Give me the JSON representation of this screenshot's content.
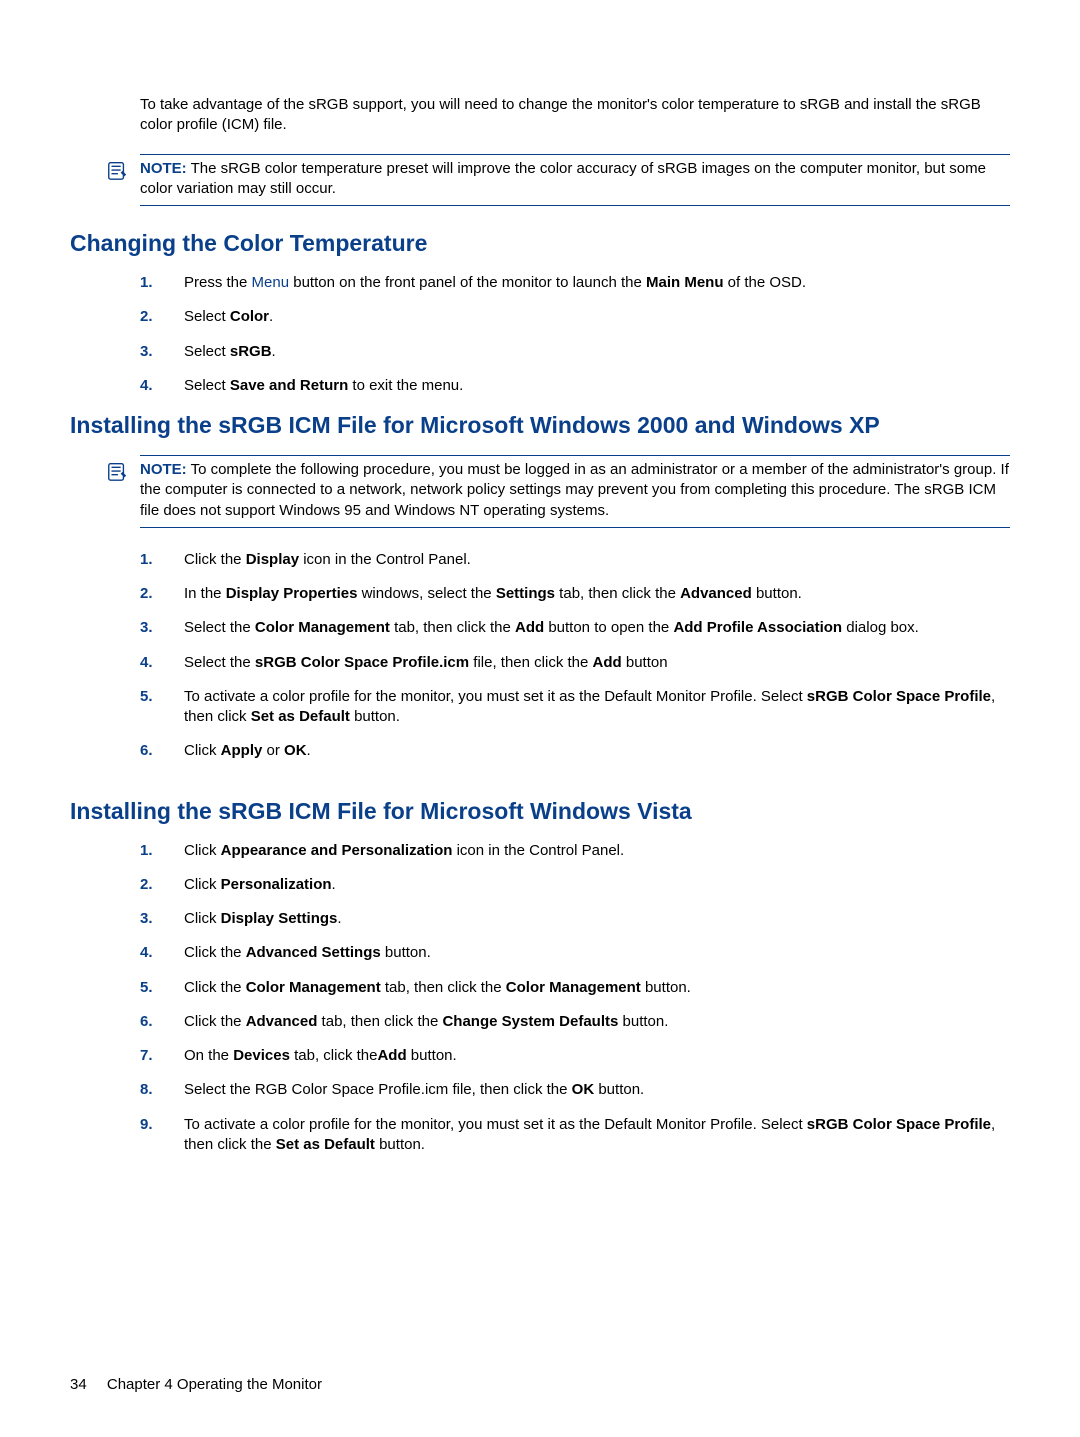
{
  "intro": {
    "para": "To take advantage of the sRGB support, you will need to change the monitor's color temperature to sRGB and install the sRGB color profile (ICM) file.",
    "note_label": "NOTE:",
    "note_text": "The sRGB color temperature preset will improve the color accuracy of sRGB images on the computer monitor, but some color variation may still occur."
  },
  "sec1": {
    "title": "Changing the Color Temperature",
    "steps": {
      "s1a": "Press the ",
      "s1_link": "Menu",
      "s1b": " button on the front panel of the monitor to launch the ",
      "s1_bold": "Main Menu",
      "s1c": " of the OSD.",
      "s2a": "Select ",
      "s2_bold": "Color",
      "s2b": ".",
      "s3a": "Select ",
      "s3_bold": "sRGB",
      "s3b": ".",
      "s4a": "Select ",
      "s4_bold": "Save and Return",
      "s4b": " to exit the menu."
    }
  },
  "sec2": {
    "title": "Installing the sRGB ICM File for Microsoft Windows 2000 and Windows XP",
    "note_label": "NOTE:",
    "note_text": "To complete the following procedure, you must be logged in as an administrator or a member of the administrator's group. If the computer is connected to a network, network policy settings may prevent you from completing this procedure. The sRGB ICM file does not support Windows 95 and Windows NT operating systems.",
    "steps": {
      "s1a": "Click the ",
      "s1b1": "Display",
      "s1b": " icon in the Control Panel.",
      "s2a": "In the ",
      "s2b1": "Display Properties",
      "s2b": " windows, select the ",
      "s2b2": "Settings",
      "s2c": " tab, then click the ",
      "s2b3": "Advanced",
      "s2d": " button.",
      "s3a": "Select the ",
      "s3b1": "Color Management",
      "s3b": " tab, then click the ",
      "s3b2": "Add",
      "s3c": " button to open the ",
      "s3b3": "Add Profile Association",
      "s3d": " dialog box.",
      "s4a": "Select the ",
      "s4b1": "sRGB Color Space Profile.icm",
      "s4b": " file, then click the ",
      "s4b2": "Add",
      "s4c": " button",
      "s5a": "To activate a color profile for the monitor, you must set it as the Default Monitor Profile. Select ",
      "s5b1": "sRGB Color Space Profile",
      "s5b": ", then click ",
      "s5b2": "Set as Default",
      "s5c": " button.",
      "s6a": "Click ",
      "s6b1": "Apply",
      "s6b": " or ",
      "s6b2": "OK",
      "s6c": "."
    }
  },
  "sec3": {
    "title": "Installing the sRGB ICM File for Microsoft Windows Vista",
    "steps": {
      "s1a": "Click ",
      "s1b1": "Appearance and Personalization",
      "s1b": " icon in the Control Panel.",
      "s2a": "Click ",
      "s2b1": "Personalization",
      "s2b": ".",
      "s3a": "Click ",
      "s3b1": "Display Settings",
      "s3b": ".",
      "s4a": "Click the ",
      "s4b1": "Advanced Settings",
      "s4b": " button.",
      "s5a": "Click the ",
      "s5b1": "Color Management",
      "s5b": " tab, then click the ",
      "s5b2": "Color Management",
      "s5c": " button.",
      "s6a": "Click the ",
      "s6b1": "Advanced",
      "s6b": " tab, then click the ",
      "s6b2": "Change System Defaults",
      "s6c": " button.",
      "s7a": "On the ",
      "s7b1": "Devices",
      "s7b": " tab, click the",
      "s7b2": "Add",
      "s7c": " button.",
      "s8a": "Select the RGB Color Space Profile.icm file, then click the ",
      "s8b1": "OK",
      "s8b": " button.",
      "s9a": "To activate a color profile for the monitor, you must set it as the Default Monitor Profile. Select ",
      "s9b1": "sRGB Color Space Profile",
      "s9b": ", then click the ",
      "s9b2": "Set as Default",
      "s9c": " button."
    }
  },
  "footer": {
    "page": "34",
    "chapter": "Chapter 4   Operating the Monitor"
  },
  "nums": {
    "n1": "1.",
    "n2": "2.",
    "n3": "3.",
    "n4": "4.",
    "n5": "5.",
    "n6": "6.",
    "n7": "7.",
    "n8": "8.",
    "n9": "9."
  }
}
